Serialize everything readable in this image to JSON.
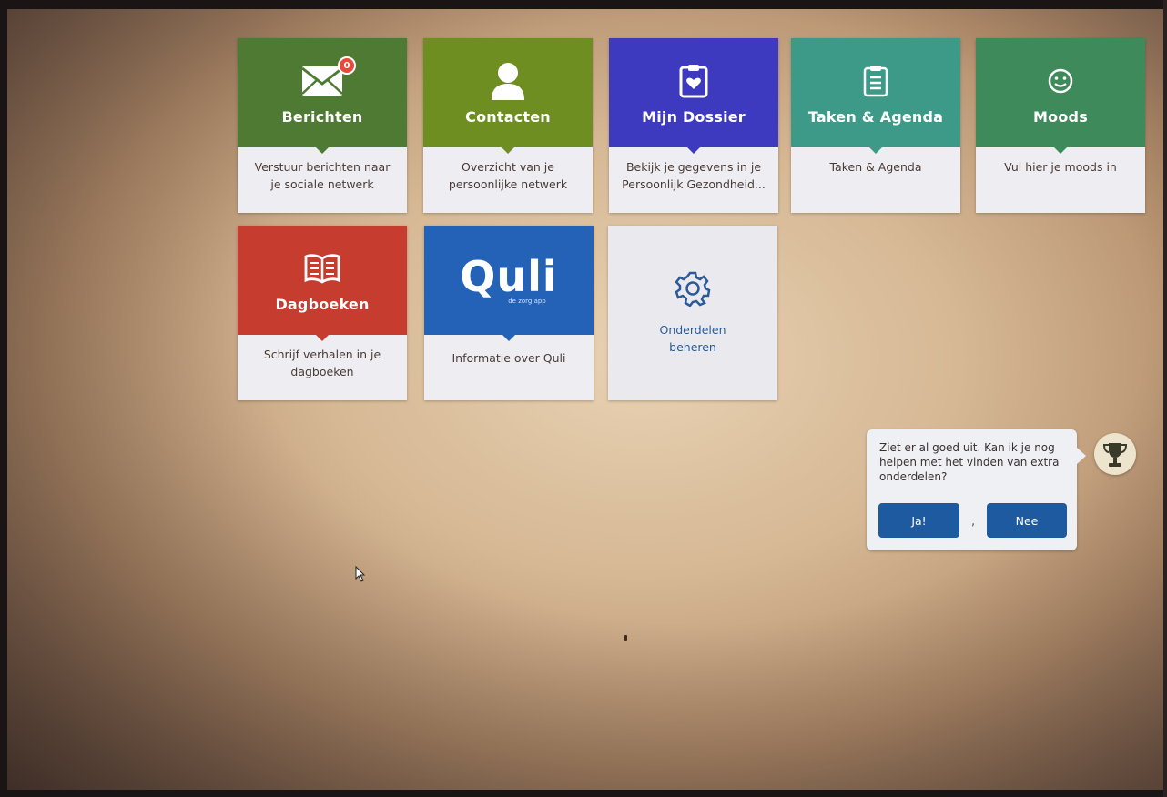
{
  "tiles": {
    "berichten": {
      "title": "Berichten",
      "description": "Verstuur berichten naar je sociale netwerk",
      "badge": "0",
      "color": "#4e7a34"
    },
    "contacten": {
      "title": "Contacten",
      "description": "Overzicht van je persoonlijke netwerk",
      "color": "#6e8e22"
    },
    "dossier": {
      "title": "Mijn Dossier",
      "description": "Bekijk je gegevens in je Persoonlijk Gezondheid...",
      "color": "#3e3ac0"
    },
    "taken": {
      "title": "Taken & Agenda",
      "description": "Taken & Agenda",
      "color": "#3e9a88"
    },
    "moods": {
      "title": "Moods",
      "description": "Vul hier je moods in",
      "color": "#3e8a5a"
    },
    "dagboeken": {
      "title": "Dagboeken",
      "description": "Schrijf verhalen in je dagboeken",
      "color": "#c63c2e"
    },
    "quli": {
      "logo": "Quli",
      "tagline": "de zorg app",
      "description": "Informatie over Quli",
      "color": "#2462b8"
    },
    "onderdelen": {
      "label": "Onderdelen beheren"
    }
  },
  "assistant": {
    "message": "Ziet er al goed uit. Kan ik je nog helpen met het vinden van extra onderdelen?",
    "yes_label": "Ja!",
    "separator": ",",
    "no_label": "Nee"
  }
}
